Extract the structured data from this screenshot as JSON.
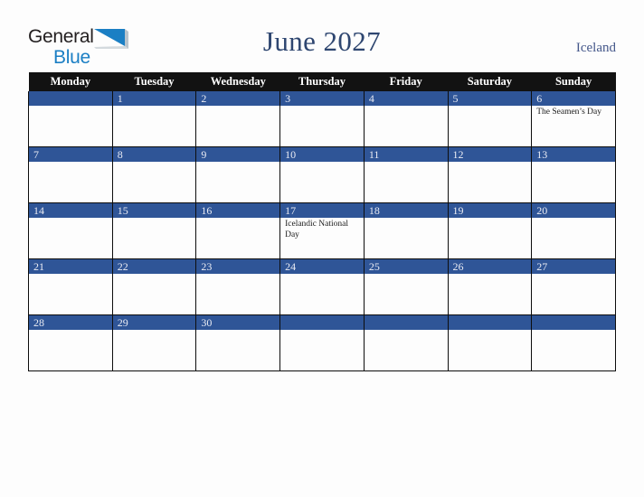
{
  "brand": {
    "name_part1": "General",
    "name_part2": "Blue",
    "flag_icon": "blue-triangle-flag-icon",
    "colors": {
      "dark": "#231f20",
      "blue": "#1b7fc4"
    }
  },
  "header": {
    "title": "June 2027",
    "country": "Iceland",
    "title_color": "#2e4670",
    "country_color": "#44578a"
  },
  "calendar": {
    "month": "June",
    "year": "2027",
    "colors": {
      "weekday_header_bg": "#121212",
      "weekday_header_text": "#ffffff",
      "daynum_bar_bg": "#2f5597",
      "daynum_text": "#e9ebf3",
      "cell_bg": "#fdfdfd",
      "grid_border": "#0d0d0d",
      "event_text": "#1a1a1a"
    },
    "weekdays": [
      "Monday",
      "Tuesday",
      "Wednesday",
      "Thursday",
      "Friday",
      "Saturday",
      "Sunday"
    ],
    "weeks": [
      [
        {
          "day": "",
          "event": ""
        },
        {
          "day": "1",
          "event": ""
        },
        {
          "day": "2",
          "event": ""
        },
        {
          "day": "3",
          "event": ""
        },
        {
          "day": "4",
          "event": ""
        },
        {
          "day": "5",
          "event": ""
        },
        {
          "day": "6",
          "event": "The Seamen’s Day"
        }
      ],
      [
        {
          "day": "7",
          "event": ""
        },
        {
          "day": "8",
          "event": ""
        },
        {
          "day": "9",
          "event": ""
        },
        {
          "day": "10",
          "event": ""
        },
        {
          "day": "11",
          "event": ""
        },
        {
          "day": "12",
          "event": ""
        },
        {
          "day": "13",
          "event": ""
        }
      ],
      [
        {
          "day": "14",
          "event": ""
        },
        {
          "day": "15",
          "event": ""
        },
        {
          "day": "16",
          "event": ""
        },
        {
          "day": "17",
          "event": "Icelandic National Day"
        },
        {
          "day": "18",
          "event": ""
        },
        {
          "day": "19",
          "event": ""
        },
        {
          "day": "20",
          "event": ""
        }
      ],
      [
        {
          "day": "21",
          "event": ""
        },
        {
          "day": "22",
          "event": ""
        },
        {
          "day": "23",
          "event": ""
        },
        {
          "day": "24",
          "event": ""
        },
        {
          "day": "25",
          "event": ""
        },
        {
          "day": "26",
          "event": ""
        },
        {
          "day": "27",
          "event": ""
        }
      ],
      [
        {
          "day": "28",
          "event": ""
        },
        {
          "day": "29",
          "event": ""
        },
        {
          "day": "30",
          "event": ""
        },
        {
          "day": "",
          "event": ""
        },
        {
          "day": "",
          "event": ""
        },
        {
          "day": "",
          "event": ""
        },
        {
          "day": "",
          "event": ""
        }
      ]
    ]
  }
}
